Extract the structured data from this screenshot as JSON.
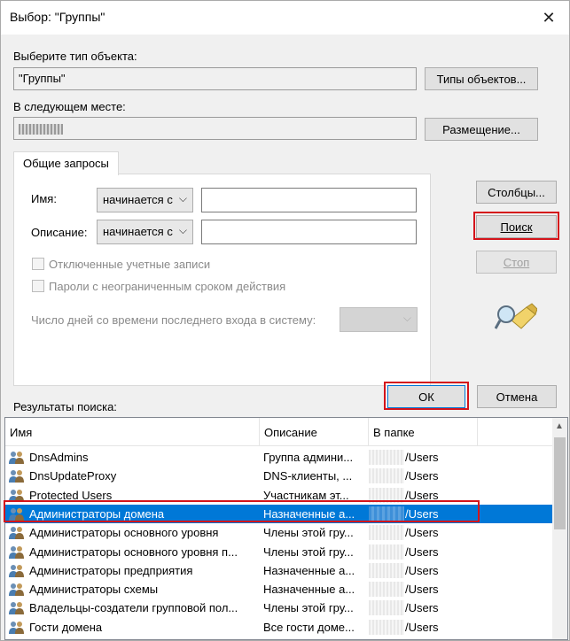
{
  "window": {
    "title": "Выбор: \"Группы\"",
    "close_glyph": "✕"
  },
  "object_type": {
    "label": "Выберите тип объекта:",
    "value": "\"Группы\"",
    "button": "Типы объектов..."
  },
  "location": {
    "label": "В следующем месте:",
    "value": "",
    "button": "Размещение..."
  },
  "tabs": [
    {
      "label": "Общие запросы"
    }
  ],
  "query": {
    "name_label": "Имя:",
    "name_mode": "начинается с",
    "name_value": "",
    "desc_label": "Описание:",
    "desc_mode": "начинается с",
    "desc_value": "",
    "disabled_accounts_label": "Отключенные учетные записи",
    "no_expire_label": "Пароли с неограниченным сроком действия",
    "days_label": "Число дней со времени последнего входа в систему:",
    "days_value": ""
  },
  "side_buttons": {
    "columns": "Столбцы...",
    "search": "Поиск",
    "stop": "Стоп"
  },
  "dialog_buttons": {
    "ok": "ОК",
    "cancel": "Отмена"
  },
  "results": {
    "label": "Результаты поиска:",
    "columns": [
      "Имя",
      "Описание",
      "В папке"
    ],
    "rows": [
      {
        "name": "DnsAdmins",
        "description": "Группа админи...",
        "folder": "/Users",
        "selected": false
      },
      {
        "name": "DnsUpdateProxy",
        "description": "DNS-клиенты, ...",
        "folder": "/Users",
        "selected": false
      },
      {
        "name": "Protected Users",
        "description": "Участникам эт...",
        "folder": "/Users",
        "selected": false
      },
      {
        "name": "Администраторы домена",
        "description": "Назначенные а...",
        "folder": "/Users",
        "selected": true
      },
      {
        "name": "Администраторы основного уровня",
        "description": "Члены этой гру...",
        "folder": "/Users",
        "selected": false
      },
      {
        "name": "Администраторы основного уровня п...",
        "description": "Члены этой гру...",
        "folder": "/Users",
        "selected": false
      },
      {
        "name": "Администраторы предприятия",
        "description": "Назначенные а...",
        "folder": "/Users",
        "selected": false
      },
      {
        "name": "Администраторы схемы",
        "description": "Назначенные а...",
        "folder": "/Users",
        "selected": false
      },
      {
        "name": "Владельцы-создатели групповой пол...",
        "description": "Члены этой гру...",
        "folder": "/Users",
        "selected": false
      },
      {
        "name": "Гости домена",
        "description": "Все гости доме...",
        "folder": "/Users",
        "selected": false
      }
    ]
  },
  "colors": {
    "selection": "#0078d7",
    "highlight": "#d4141b"
  }
}
